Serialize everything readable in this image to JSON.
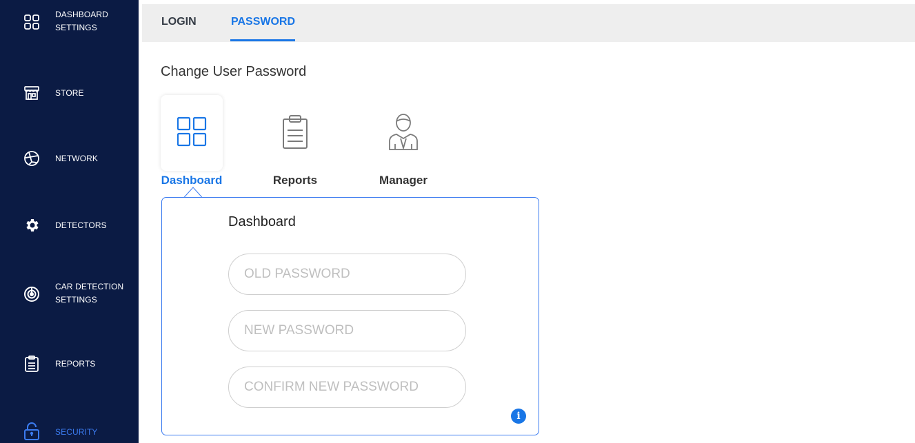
{
  "sidebar": {
    "items": [
      {
        "label_line1": "DASHBOARD",
        "label_line2": "SETTINGS",
        "icon": "grid-icon"
      },
      {
        "label": "STORE",
        "icon": "store-icon"
      },
      {
        "label": "NETWORK",
        "icon": "network-icon"
      },
      {
        "label": "DETECTORS",
        "icon": "gear-icon"
      },
      {
        "label_line1": "CAR DETECTION",
        "label_line2": "SETTINGS",
        "icon": "radar-icon"
      },
      {
        "label": "REPORTS",
        "icon": "clipboard-icon"
      },
      {
        "label": "SECURITY",
        "icon": "lock-icon",
        "active": true
      }
    ]
  },
  "tabs": [
    {
      "label": "LOGIN"
    },
    {
      "label": "PASSWORD",
      "active": true
    }
  ],
  "page_title": "Change User Password",
  "roles": [
    {
      "label": "Dashboard",
      "icon": "grid-icon",
      "active": true
    },
    {
      "label": "Reports",
      "icon": "clipboard-icon"
    },
    {
      "label": "Manager",
      "icon": "manager-icon"
    }
  ],
  "form": {
    "title": "Dashboard",
    "old_password_placeholder": "OLD PASSWORD",
    "new_password_placeholder": "NEW PASSWORD",
    "confirm_password_placeholder": "CONFIRM NEW PASSWORD",
    "info_glyph": "i"
  },
  "colors": {
    "sidebar_bg": "#0b1b44",
    "accent": "#1976e6",
    "tabbar_bg": "#eeeeee"
  }
}
